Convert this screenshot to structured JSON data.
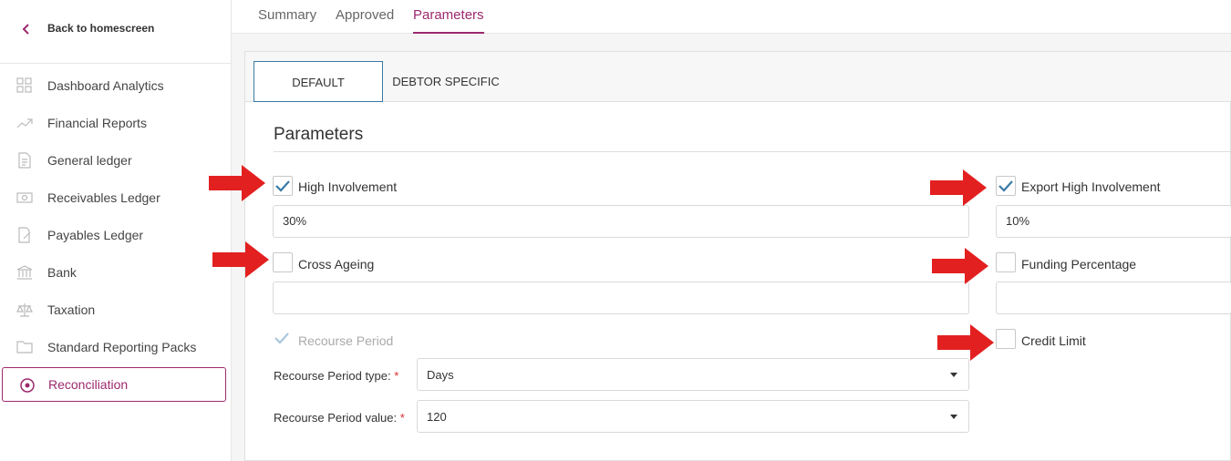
{
  "sidebar": {
    "back_label": "Back to homescreen",
    "items": [
      {
        "label": "Dashboard Analytics",
        "icon": "grid-icon"
      },
      {
        "label": "Financial Reports",
        "icon": "trend-icon"
      },
      {
        "label": "General ledger",
        "icon": "document-icon"
      },
      {
        "label": "Receivables Ledger",
        "icon": "banknote-icon"
      },
      {
        "label": "Payables Ledger",
        "icon": "edit-document-icon"
      },
      {
        "label": "Bank",
        "icon": "bank-icon"
      },
      {
        "label": "Taxation",
        "icon": "scales-icon"
      },
      {
        "label": "Standard Reporting Packs",
        "icon": "folder-icon"
      },
      {
        "label": "Reconciliation",
        "icon": "target-icon",
        "active": true
      }
    ]
  },
  "top_tabs": [
    {
      "label": "Summary"
    },
    {
      "label": "Approved"
    },
    {
      "label": "Parameters",
      "active": true
    }
  ],
  "sub_tabs": [
    {
      "label": "DEFAULT",
      "active": true
    },
    {
      "label": "DEBTOR SPECIFIC"
    }
  ],
  "section_title": "Parameters",
  "params": {
    "high_involvement": {
      "label": "High Involvement",
      "checked": true,
      "value": "30%"
    },
    "export_high_involvement": {
      "label": "Export High Involvement",
      "checked": true,
      "value": "10%"
    },
    "cross_ageing": {
      "label": "Cross Ageing",
      "checked": false,
      "value": ""
    },
    "funding_percentage": {
      "label": "Funding Percentage",
      "checked": false,
      "value": ""
    },
    "recourse_period": {
      "label": "Recourse Period",
      "checked": true,
      "disabled": true
    },
    "credit_limit": {
      "label": "Credit Limit",
      "checked": false
    },
    "recourse_period_type": {
      "label": "Recourse Period type:",
      "required_mark": "*",
      "value": "Days"
    },
    "recourse_period_value": {
      "label": "Recourse Period value:",
      "required_mark": "*",
      "value": "120"
    }
  },
  "colors": {
    "accent": "#9c2a6e",
    "check": "#3a7aa6",
    "arrow": "#e32020"
  }
}
